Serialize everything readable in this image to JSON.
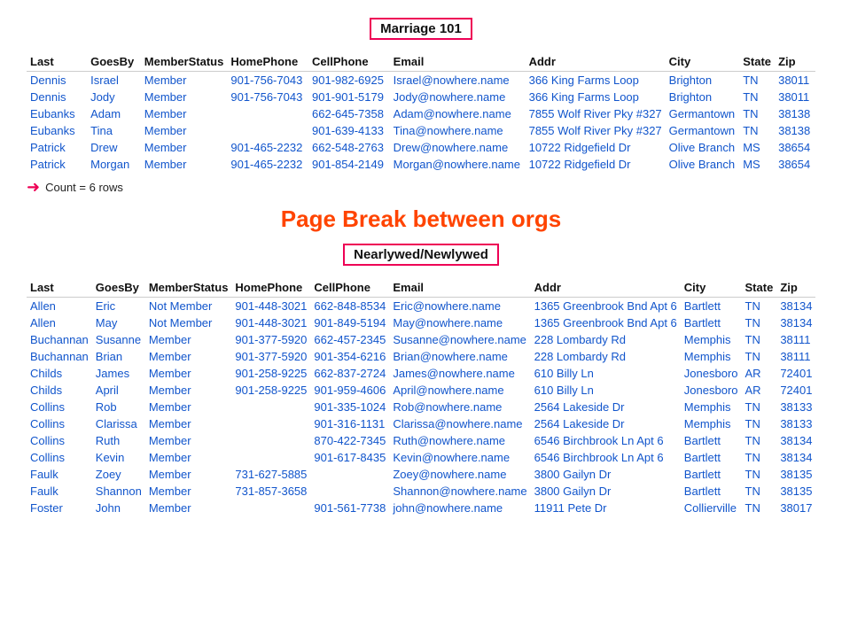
{
  "sections": [
    {
      "title": "Marriage 101",
      "columns": [
        "Last",
        "GoesBy",
        "MemberStatus",
        "HomePhone",
        "CellPhone",
        "Email",
        "Addr",
        "City",
        "State",
        "Zip"
      ],
      "rows": [
        [
          "Dennis",
          "Israel",
          "Member",
          "901-756-7043",
          "901-982-6925",
          "Israel@nowhere.name",
          "366 King Farms Loop",
          "Brighton",
          "TN",
          "38011"
        ],
        [
          "Dennis",
          "Jody",
          "Member",
          "901-756-7043",
          "901-901-5179",
          "Jody@nowhere.name",
          "366 King Farms Loop",
          "Brighton",
          "TN",
          "38011"
        ],
        [
          "Eubanks",
          "Adam",
          "Member",
          "",
          "662-645-7358",
          "Adam@nowhere.name",
          "7855 Wolf River Pky #327",
          "Germantown",
          "TN",
          "38138"
        ],
        [
          "Eubanks",
          "Tina",
          "Member",
          "",
          "901-639-4133",
          "Tina@nowhere.name",
          "7855 Wolf River Pky #327",
          "Germantown",
          "TN",
          "38138"
        ],
        [
          "Patrick",
          "Drew",
          "Member",
          "901-465-2232",
          "662-548-2763",
          "Drew@nowhere.name",
          "10722 Ridgefield Dr",
          "Olive Branch",
          "MS",
          "38654"
        ],
        [
          "Patrick",
          "Morgan",
          "Member",
          "901-465-2232",
          "901-854-2149",
          "Morgan@nowhere.name",
          "10722 Ridgefield Dr",
          "Olive Branch",
          "MS",
          "38654"
        ]
      ],
      "count": "Count = 6 rows"
    },
    {
      "title": "Nearlywed/Newlywed",
      "columns": [
        "Last",
        "GoesBy",
        "MemberStatus",
        "HomePhone",
        "CellPhone",
        "Email",
        "Addr",
        "City",
        "State",
        "Zip"
      ],
      "rows": [
        [
          "Allen",
          "Eric",
          "Not Member",
          "901-448-3021",
          "662-848-8534",
          "Eric@nowhere.name",
          "1365 Greenbrook Bnd Apt 6",
          "Bartlett",
          "TN",
          "38134"
        ],
        [
          "Allen",
          "May",
          "Not Member",
          "901-448-3021",
          "901-849-5194",
          "May@nowhere.name",
          "1365 Greenbrook Bnd Apt 6",
          "Bartlett",
          "TN",
          "38134"
        ],
        [
          "Buchannan",
          "Susanne",
          "Member",
          "901-377-5920",
          "662-457-2345",
          "Susanne@nowhere.name",
          "228 Lombardy Rd",
          "Memphis",
          "TN",
          "38111"
        ],
        [
          "Buchannan",
          "Brian",
          "Member",
          "901-377-5920",
          "901-354-6216",
          "Brian@nowhere.name",
          "228 Lombardy Rd",
          "Memphis",
          "TN",
          "38111"
        ],
        [
          "Childs",
          "James",
          "Member",
          "901-258-9225",
          "662-837-2724",
          "James@nowhere.name",
          "610 Billy Ln",
          "Jonesboro",
          "AR",
          "72401"
        ],
        [
          "Childs",
          "April",
          "Member",
          "901-258-9225",
          "901-959-4606",
          "April@nowhere.name",
          "610 Billy Ln",
          "Jonesboro",
          "AR",
          "72401"
        ],
        [
          "Collins",
          "Rob",
          "Member",
          "",
          "901-335-1024",
          "Rob@nowhere.name",
          "2564 Lakeside Dr",
          "Memphis",
          "TN",
          "38133"
        ],
        [
          "Collins",
          "Clarissa",
          "Member",
          "",
          "901-316-1131",
          "Clarissa@nowhere.name",
          "2564 Lakeside Dr",
          "Memphis",
          "TN",
          "38133"
        ],
        [
          "Collins",
          "Ruth",
          "Member",
          "",
          "870-422-7345",
          "Ruth@nowhere.name",
          "6546 Birchbrook Ln Apt 6",
          "Bartlett",
          "TN",
          "38134"
        ],
        [
          "Collins",
          "Kevin",
          "Member",
          "",
          "901-617-8435",
          "Kevin@nowhere.name",
          "6546 Birchbrook Ln Apt 6",
          "Bartlett",
          "TN",
          "38134"
        ],
        [
          "Faulk",
          "Zoey",
          "Member",
          "731-627-5885",
          "",
          "Zoey@nowhere.name",
          "3800 Gailyn Dr",
          "Bartlett",
          "TN",
          "38135"
        ],
        [
          "Faulk",
          "Shannon",
          "Member",
          "731-857-3658",
          "",
          "Shannon@nowhere.name",
          "3800 Gailyn Dr",
          "Bartlett",
          "TN",
          "38135"
        ],
        [
          "Foster",
          "John",
          "Member",
          "",
          "901-561-7738",
          "john@nowhere.name",
          "11911 Pete Dr",
          "Collierville",
          "TN",
          "38017"
        ]
      ]
    }
  ],
  "pageBreakText": "Page Break between orgs"
}
